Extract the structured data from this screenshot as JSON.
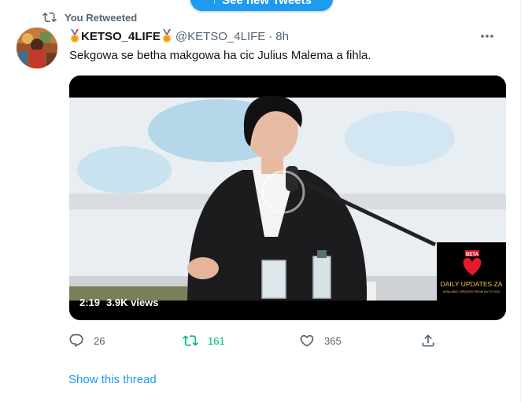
{
  "new_tweets_pill": {
    "label": "See new Tweets"
  },
  "tweet": {
    "retweet_context": "You Retweeted",
    "display_name": "KETSO_4LIFE",
    "handle": "@KETSO_4LIFE",
    "separator": "·",
    "time": "8h",
    "text": "Sekgowa se betha makgowa ha cic Julius Malema a fihla.",
    "video": {
      "duration": "2:19",
      "views": "3.9K views",
      "watermark_badge": "BETA",
      "watermark_title": "DAILY UPDATES ZA",
      "watermark_sub": "AVAILABLE UPDATES FROM SA TO YOU"
    },
    "actions": {
      "replies": "26",
      "retweets": "161",
      "likes": "365"
    },
    "show_thread": "Show this thread"
  },
  "colors": {
    "accent": "#1d9bf0",
    "retweet_active": "#00ba7c",
    "secondary_text": "#536471"
  }
}
